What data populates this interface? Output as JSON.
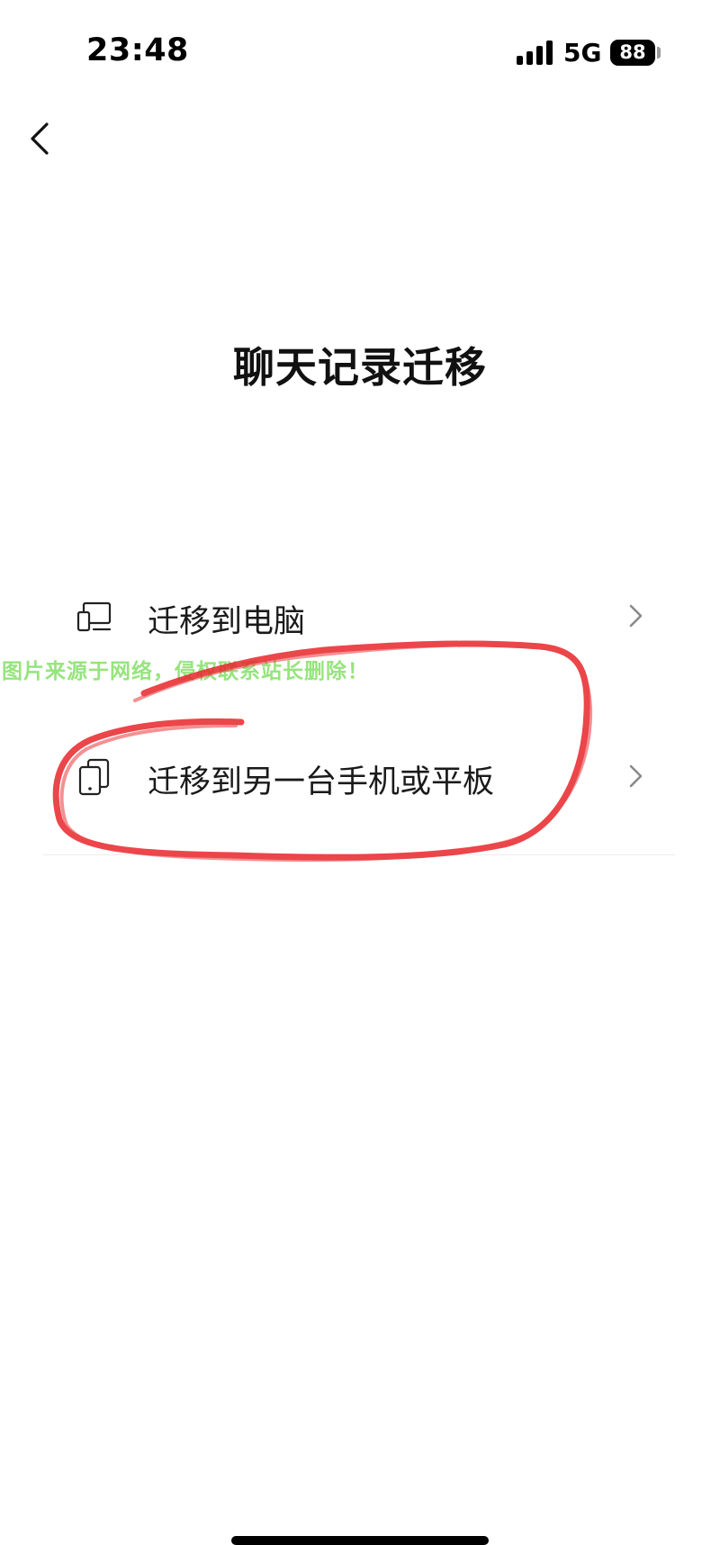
{
  "status_bar": {
    "time": "23:48",
    "network": "5G",
    "battery": "88",
    "icons": [
      "signal-icon",
      "battery-icon"
    ]
  },
  "nav": {
    "back_icon": "chevron-left-icon"
  },
  "title": "聊天记录迁移",
  "options": [
    {
      "label": "迁移到电脑",
      "icon": "computer-icon",
      "chevron": "chevron-right-icon"
    },
    {
      "label": "迁移到另一台手机或平板",
      "icon": "phone-tablet-icon",
      "chevron": "chevron-right-icon"
    }
  ],
  "watermark": "图片来源于网络，侵权联系站长删除！",
  "colors": {
    "annotation": "#e8262b",
    "watermark": "#8be26f",
    "text": "#111111",
    "chevron": "#8a8a8a"
  }
}
